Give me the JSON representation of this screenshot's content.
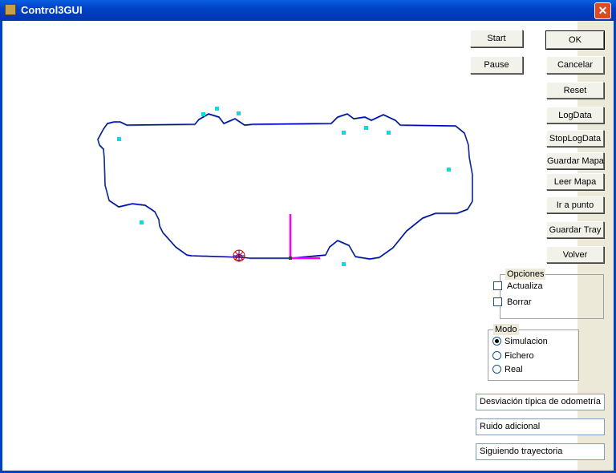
{
  "window": {
    "title": "Control3GUI",
    "close_glyph": "✕"
  },
  "buttons": {
    "start": "Start",
    "pause": "Pause",
    "ok": "OK",
    "cancelar": "Cancelar",
    "reset": "Reset",
    "logdata": "LogData",
    "stoplogdata": "StopLogData",
    "guardar_mapa": "Guardar Mapa",
    "leer_mapa": "Leer Mapa",
    "ir_a_punto": "Ir a punto",
    "guardar_tray": "Guardar Tray",
    "volver": "Volver"
  },
  "opciones": {
    "title": "Opciones",
    "actualiza": {
      "label": "Actualiza",
      "checked": false
    },
    "borrar": {
      "label": "Borrar",
      "checked": false
    }
  },
  "modo": {
    "title": "Modo",
    "options": [
      {
        "label": "Simulacion",
        "selected": true
      },
      {
        "label": "Fichero",
        "selected": false
      },
      {
        "label": "Real",
        "selected": false
      }
    ]
  },
  "status": {
    "field1": "Desviación típica de odometría",
    "field2": "Ruido adicional",
    "field3": "Siguiendo trayectoria"
  },
  "colors": {
    "path": "#0000c0",
    "landmarks": "#00e0e0",
    "robot_axis": "#ff00ff"
  }
}
